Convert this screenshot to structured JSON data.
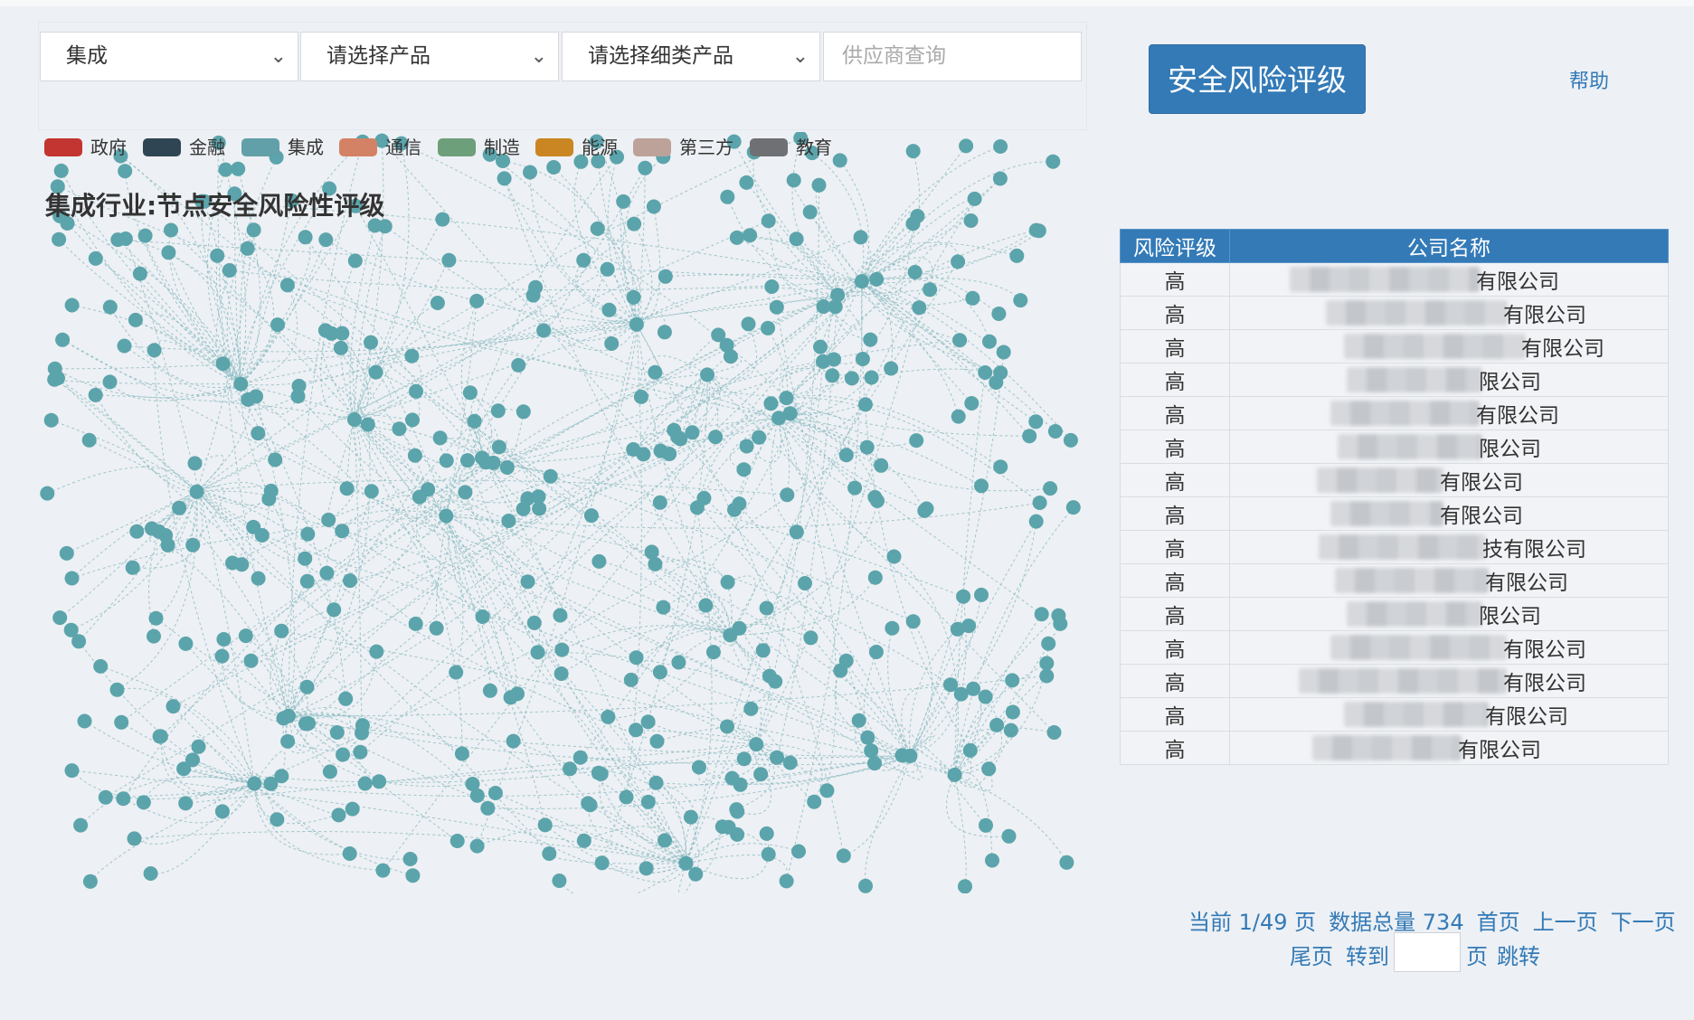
{
  "filters": {
    "industry": "集成",
    "product_placeholder": "请选择产品",
    "subproduct_placeholder": "请选择细类产品",
    "supplier_placeholder": "供应商查询"
  },
  "rating_button": "安全风险评级",
  "help": "帮助",
  "legend": [
    {
      "label": "政府",
      "color": "#c23531"
    },
    {
      "label": "金融",
      "color": "#2f4554"
    },
    {
      "label": "集成",
      "color": "#61a0a8"
    },
    {
      "label": "通信",
      "color": "#d48265"
    },
    {
      "label": "制造",
      "color": "#6d9f7a"
    },
    {
      "label": "能源",
      "color": "#ca8622"
    },
    {
      "label": "第三方",
      "color": "#bda29a"
    },
    {
      "label": "教育",
      "color": "#6e7074"
    }
  ],
  "graph": {
    "title": "集成行业:节点安全风险性评级",
    "node_color": "#5ba4ab",
    "edge_color": "#8fbec4"
  },
  "table": {
    "headers": [
      "风险评级",
      "公司名称"
    ],
    "rows": [
      {
        "rating": "高",
        "name_visible": "有限公司"
      },
      {
        "rating": "高",
        "name_visible": "有限公司"
      },
      {
        "rating": "高",
        "name_visible": "有限公司"
      },
      {
        "rating": "高",
        "name_visible": "限公司"
      },
      {
        "rating": "高",
        "name_visible": "有限公司"
      },
      {
        "rating": "高",
        "name_visible": "限公司"
      },
      {
        "rating": "高",
        "name_visible": "有限公司"
      },
      {
        "rating": "高",
        "name_visible": "有限公司"
      },
      {
        "rating": "高",
        "name_visible": "技有限公司"
      },
      {
        "rating": "高",
        "name_visible": "有限公司"
      },
      {
        "rating": "高",
        "name_visible": "限公司"
      },
      {
        "rating": "高",
        "name_visible": "有限公司"
      },
      {
        "rating": "高",
        "name_visible": "有限公司"
      },
      {
        "rating": "高",
        "name_visible": "有限公司"
      },
      {
        "rating": "高",
        "name_visible": "有限公司"
      }
    ]
  },
  "pagination": {
    "current": "当前 1/49 页",
    "total": "数据总量 734",
    "first": "首页",
    "prev": "上一页",
    "next": "下一页",
    "last": "尾页",
    "goto": "转到",
    "page_unit": "页",
    "jump": "跳转"
  }
}
